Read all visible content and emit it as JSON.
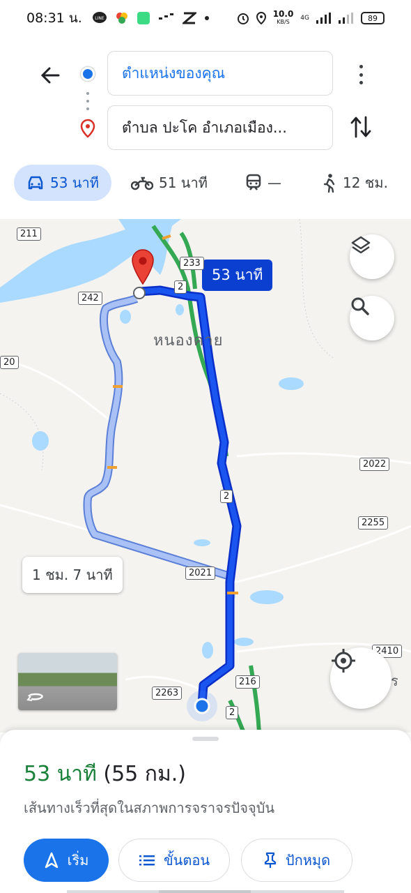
{
  "status_bar": {
    "time": "08:31 น.",
    "net_speed_value": "10.0",
    "net_speed_unit": "KB/S",
    "network": "4G",
    "battery": "89"
  },
  "directions": {
    "origin": "ตำแหน่งของคุณ",
    "destination": "ตำบล ปะโค อำเภอเมือง..."
  },
  "modes": [
    {
      "name": "driving",
      "label": "53 นาที",
      "active": true
    },
    {
      "name": "motorcycle",
      "label": "51 นาที"
    },
    {
      "name": "transit",
      "label": "—"
    },
    {
      "name": "walking",
      "label": "12 ชม."
    }
  ],
  "map": {
    "route_duration_chip": "53 นาที",
    "alt_route_chip": "1 ชม. 7 นาที",
    "town_label": "หนองคาย",
    "partial_label": "ดร",
    "road_shields": [
      "211",
      "233",
      "2",
      "242",
      "20",
      "2022",
      "2",
      "2255",
      "2021",
      "2410",
      "2263",
      "216",
      "2"
    ],
    "route_color": "#0b3fd0",
    "alt_route_color": "#8ab4f8"
  },
  "sheet": {
    "duration": "53 นาที",
    "distance": "(55 กม.)",
    "description": "เส้นทางเร็วที่สุดในสภาพการจราจรปัจจุบัน",
    "start_label": "เริ่ม",
    "steps_label": "ขั้นตอน",
    "pin_label": "ปักหมุด"
  }
}
